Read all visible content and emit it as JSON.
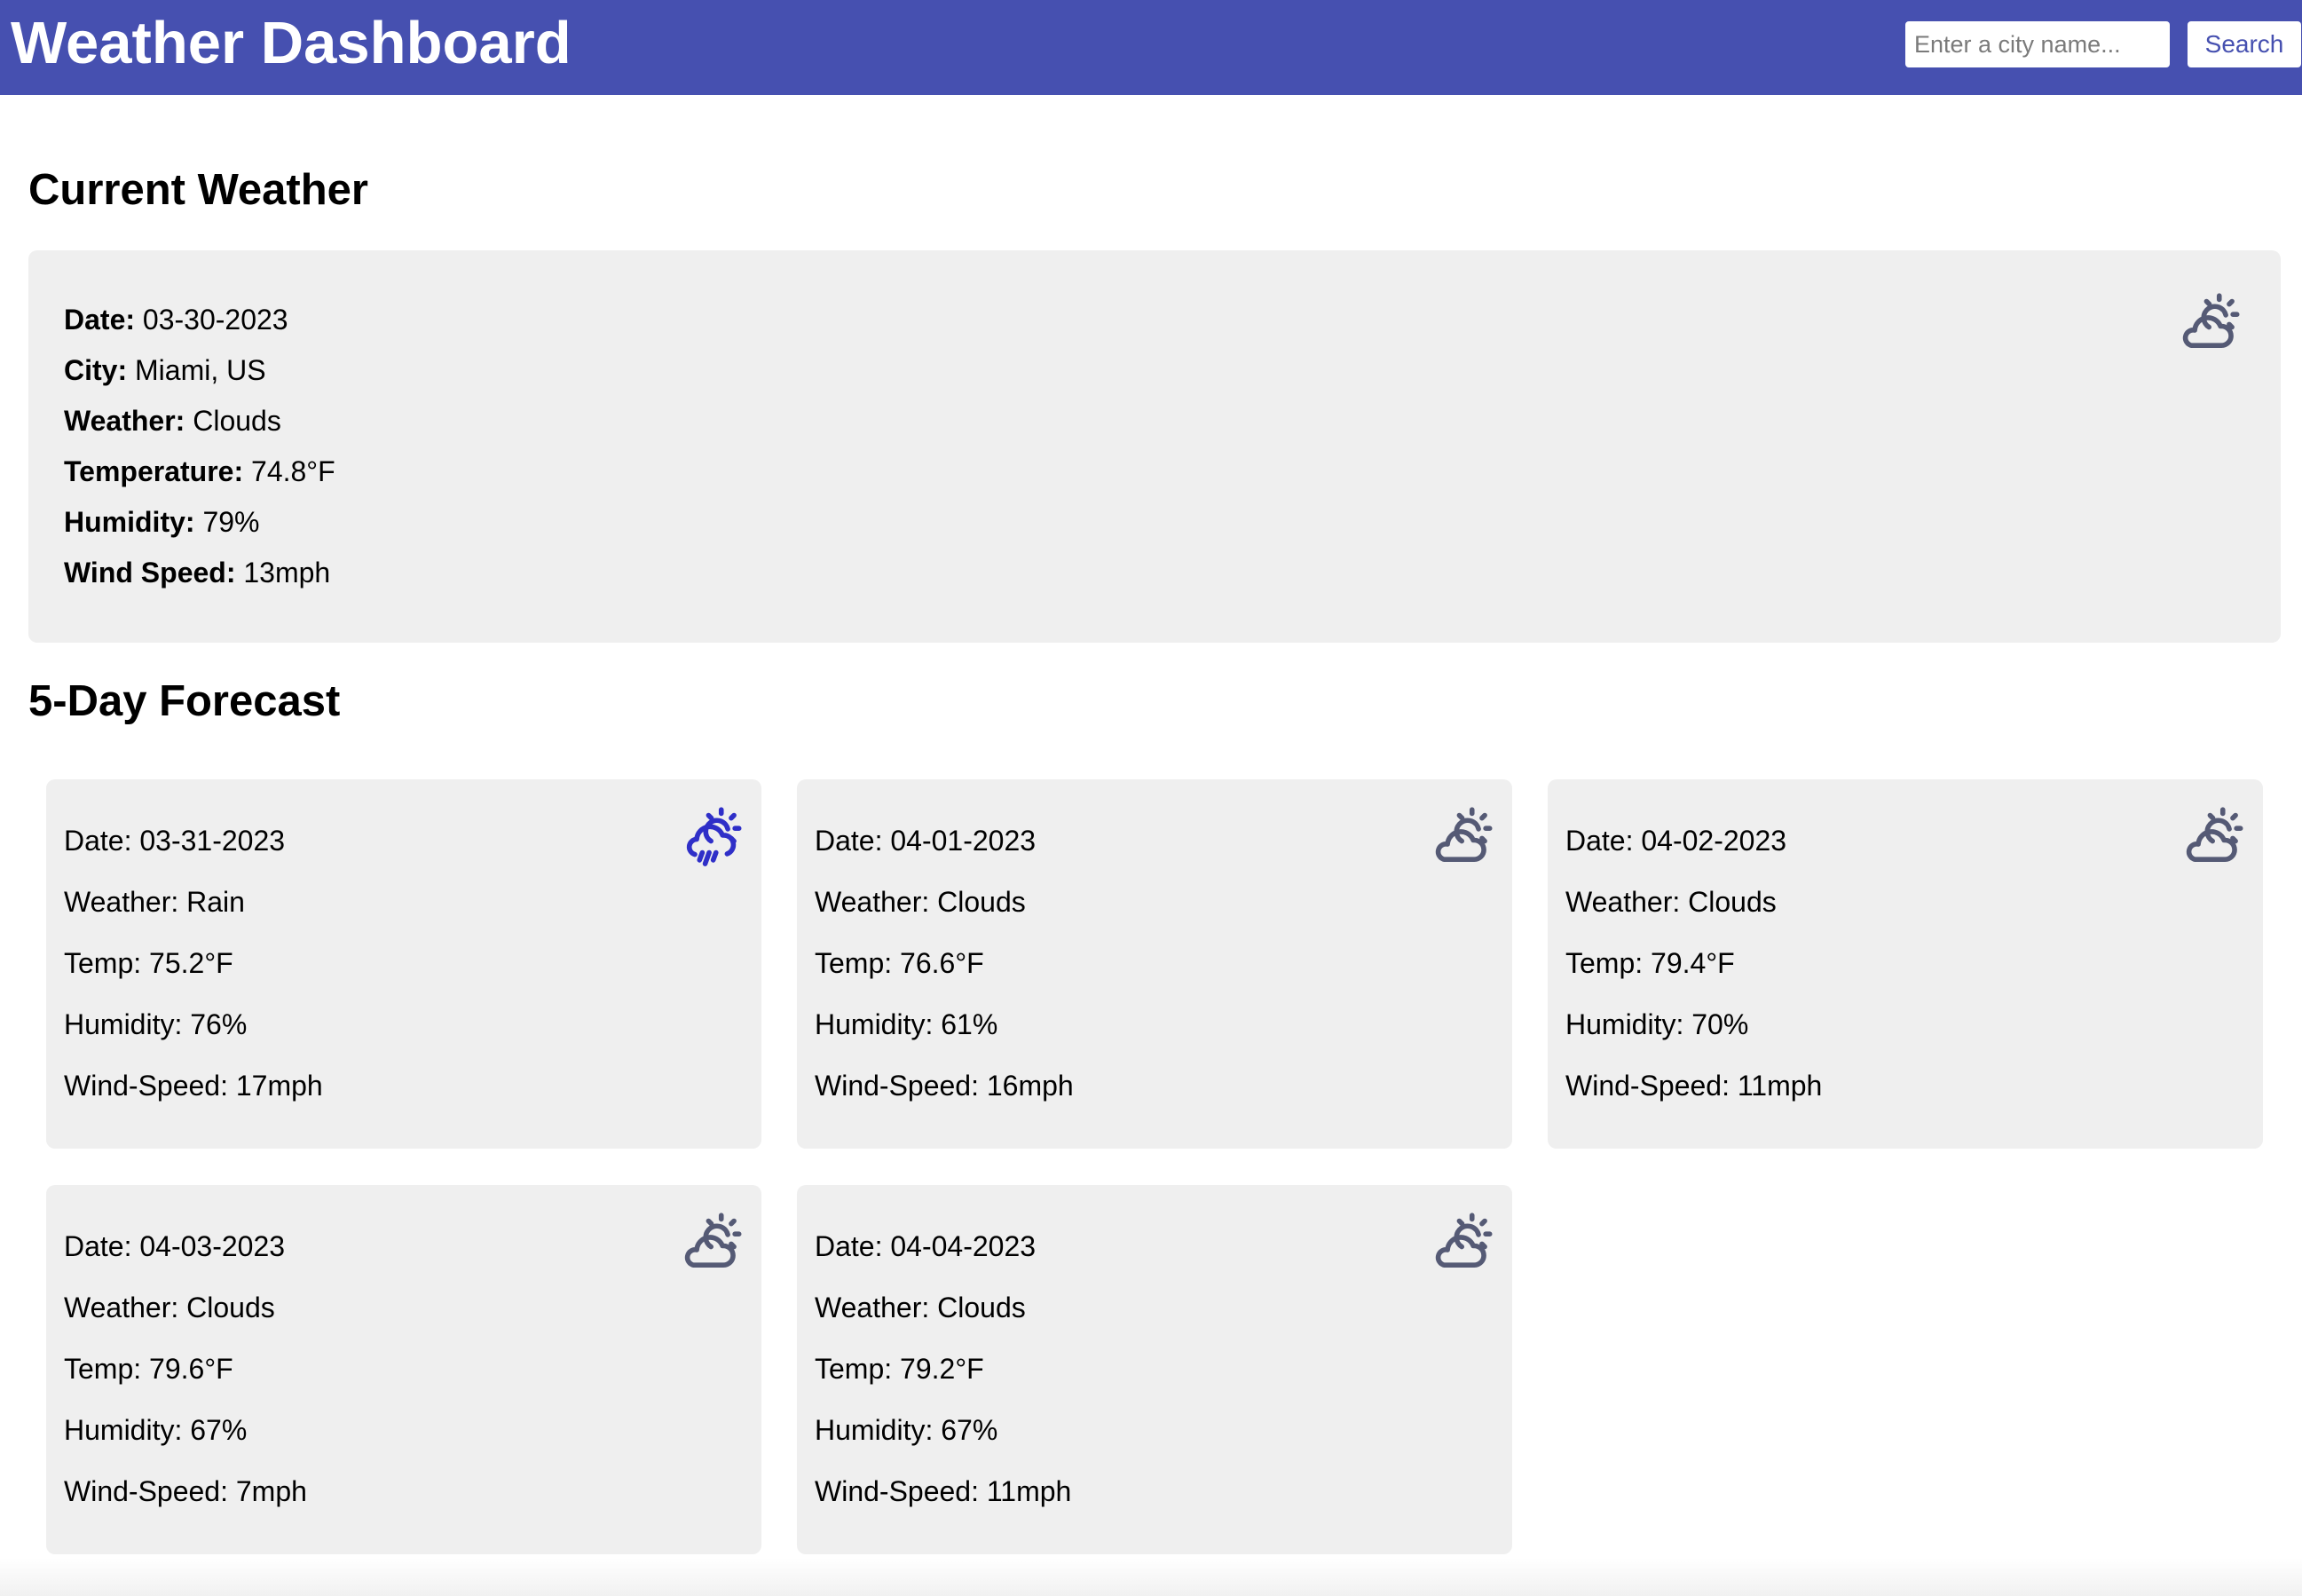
{
  "header": {
    "title": "Weather Dashboard",
    "search_placeholder": "Enter a city name...",
    "search_value": "",
    "search_button": "Search",
    "bg_color": "#4650b0"
  },
  "current": {
    "heading": "Current Weather",
    "icon": "cloud-sun-icon",
    "date_label": "Date:",
    "date": "03-30-2023",
    "city_label": "City:",
    "city": "Miami, US",
    "weather_label": "Weather:",
    "weather": "Clouds",
    "temp_label": "Temperature:",
    "temp": "74.8°F",
    "humidity_label": "Humidity:",
    "humidity": "79%",
    "wind_label": "Wind Speed:",
    "wind": "13mph"
  },
  "forecast": {
    "heading": "5-Day Forecast",
    "days": [
      {
        "date": "Date: 03-31-2023",
        "weather": "Weather: Rain",
        "temp": "Temp: 75.2°F",
        "humidity": "Humidity: 76%",
        "wind": "Wind-Speed: 17mph",
        "icon": "cloud-sun-rain-icon",
        "icon_color": "#2f2fc8"
      },
      {
        "date": "Date: 04-01-2023",
        "weather": "Weather: Clouds",
        "temp": "Temp: 76.6°F",
        "humidity": "Humidity: 61%",
        "wind": "Wind-Speed: 16mph",
        "icon": "cloud-sun-icon",
        "icon_color": "#555a75"
      },
      {
        "date": "Date: 04-02-2023",
        "weather": "Weather: Clouds",
        "temp": "Temp: 79.4°F",
        "humidity": "Humidity: 70%",
        "wind": "Wind-Speed: 11mph",
        "icon": "cloud-sun-icon",
        "icon_color": "#555a75"
      },
      {
        "date": "Date: 04-03-2023",
        "weather": "Weather: Clouds",
        "temp": "Temp: 79.6°F",
        "humidity": "Humidity: 67%",
        "wind": "Wind-Speed: 7mph",
        "icon": "cloud-sun-icon",
        "icon_color": "#555a75"
      },
      {
        "date": "Date: 04-04-2023",
        "weather": "Weather: Clouds",
        "temp": "Temp: 79.2°F",
        "humidity": "Humidity: 67%",
        "wind": "Wind-Speed: 11mph",
        "icon": "cloud-sun-icon",
        "icon_color": "#555a75"
      }
    ]
  }
}
